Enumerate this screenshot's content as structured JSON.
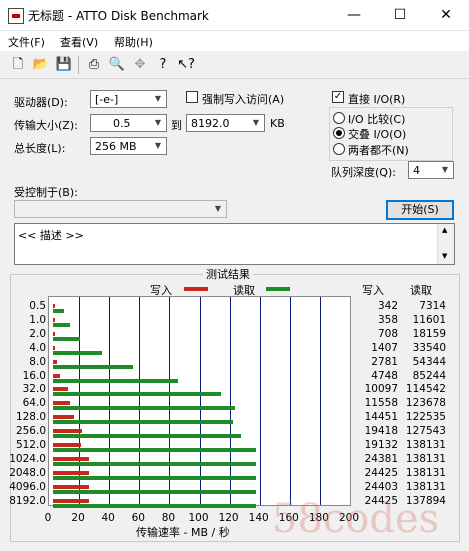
{
  "window": {
    "title": "无标题 - ATTO Disk Benchmark",
    "minimize": "—",
    "maximize": "☐",
    "close": "✕"
  },
  "menu": [
    "文件(F)",
    "查看(V)",
    "帮助(H)"
  ],
  "toolbar": [
    "new-file-icon",
    "open-folder-icon",
    "save-icon",
    "print-icon",
    "print-preview-icon",
    "move-icon",
    "help-icon",
    "context-help-icon"
  ],
  "form": {
    "drive_label": "驱动器(D):",
    "drive_value": "[-e-]",
    "transfer_size_label": "传输大小(Z):",
    "transfer_from": "0.5",
    "to_label": "到",
    "transfer_to": "8192.0",
    "kb_label": "KB",
    "total_length_label": "总长度(L):",
    "total_length": "256 MB",
    "force_write_label": "强制写入访问(A)",
    "direct_io_label": "直接 I/O(R)",
    "direct_io_checked": true,
    "io_compare_label": "I/O 比较(C)",
    "overlapped_io_label": "交叠 I/O(O)",
    "neither_label": "两者都不(N)",
    "queue_depth_label": "队列深度(Q):",
    "queue_depth": "4",
    "controlled_by_label": "受控制于(B):",
    "start_label": "开始(S)",
    "description": "<< 描述 >>"
  },
  "results": {
    "title": "测试结果",
    "legend_write": "写入",
    "legend_read": "读取",
    "col_write": "写入",
    "col_read": "读取",
    "x_axis_label": "传输速率 - MB / 秒",
    "colors": {
      "write": "#c8281e",
      "read": "#1e8c28",
      "grid": "#0a1e7e"
    }
  },
  "chart_data": {
    "type": "bar",
    "orientation": "horizontal",
    "categories": [
      "0.5",
      "1.0",
      "2.0",
      "4.0",
      "8.0",
      "16.0",
      "32.0",
      "64.0",
      "128.0",
      "256.0",
      "512.0",
      "1024.0",
      "2048.0",
      "4096.0",
      "8192.0"
    ],
    "series": [
      {
        "name": "写入",
        "values": [
          0.3,
          0.3,
          0.7,
          1.4,
          2.7,
          4.6,
          9.9,
          11.3,
          14.1,
          19.0,
          18.7,
          23.8,
          23.9,
          23.8,
          23.9
        ]
      },
      {
        "name": "读取",
        "values": [
          7.1,
          11.3,
          17.7,
          32.8,
          53.1,
          83.2,
          111.9,
          120.7,
          119.7,
          124.6,
          134.9,
          134.9,
          134.9,
          134.9,
          134.7
        ]
      }
    ],
    "write_raw": [
      "342",
      "358",
      "708",
      "1407",
      "2781",
      "4748",
      "10097",
      "11558",
      "14451",
      "19418",
      "19132",
      "24381",
      "24425",
      "24403",
      "24425"
    ],
    "read_raw": [
      "7314",
      "11601",
      "18159",
      "33540",
      "54344",
      "85244",
      "114542",
      "123678",
      "122535",
      "127543",
      "138131",
      "138131",
      "138131",
      "138131",
      "137894"
    ],
    "xticks": [
      "0",
      "20",
      "40",
      "60",
      "80",
      "100",
      "120",
      "140",
      "160",
      "180",
      "200"
    ],
    "xlim": [
      0,
      200
    ],
    "xlabel": "传输速率 - MB / 秒",
    "grid": true,
    "legend": "top"
  },
  "watermark": "58codes"
}
